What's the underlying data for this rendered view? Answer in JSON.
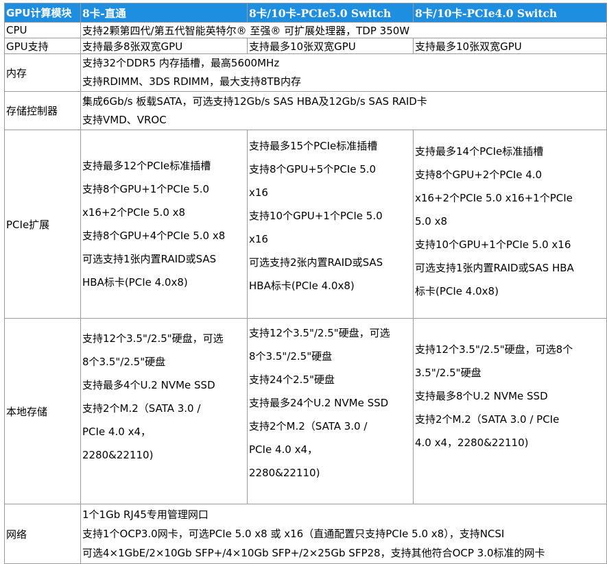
{
  "headers": [
    "GPU计算模块",
    "8卡-直通",
    "8卡/10卡-PCIe5.0 Switch",
    "8卡/10卡-PCIe4.0 Switch"
  ],
  "rows": {
    "cpu": {
      "label": "CPU",
      "value": "支持2颗第四代/第五代智能英特尔® 至强® 可扩展处理器，TDP 350W"
    },
    "gpu": {
      "label": "GPU支持",
      "col1": "支持最多8张双宽GPU",
      "col2": "支持最多10张双宽GPU",
      "col3": "支持最多10张双宽GPU"
    },
    "memory": {
      "label": "内存",
      "lines": [
        "支持32个DDR5 内存插槽，最高5600MHz",
        "支持RDIMM、3DS RDIMM，最大支持8TB内存"
      ]
    },
    "controller": {
      "label": "存储控制器",
      "lines": [
        "集成6Gb/s 板载SATA，可选支持12Gb/s SAS HBA及12Gb/s SAS RAID卡",
        "支持VMD、VROC"
      ]
    },
    "pcie": {
      "label": "PCIe扩展",
      "col1": [
        "支持最多12个PCIe标准插槽",
        "支持8个GPU+1个PCIe 5.0",
        "x16+2个PCIe 5.0 x8",
        "支持8个GPU+4个PCIe 5.0 x8",
        "可选支持1张内置RAID或SAS",
        "HBA标卡(PCIe 4.0x8)"
      ],
      "col2": [
        "支持最多15个PCIe标准插槽",
        "支持8个GPU+5个PCIe 5.0",
        "x16",
        "支持10个GPU+1个PCIe 5.0",
        "x16",
        "可选支持2张内置RAID或SAS",
        "HBA标卡(PCIe 4.0x8)"
      ],
      "col3": [
        "支持最多14个PCIe标准插槽",
        "支持8个GPU+2个PCIe 4.0",
        "x16+2个PCIe 5.0 x16+1个PCIe",
        "5.0 x8",
        "支持10个GPU+1个PCIe 5.0 x16",
        "可选支持1张内置RAID或SAS HBA",
        "标卡(PCIe 4.0x8)"
      ]
    },
    "storage": {
      "label": "本地存储",
      "col1": [
        "支持12个3.5\"/2.5\"硬盘，可选",
        "8个3.5\"/2.5\"硬盘",
        "支持最多4个U.2 NVMe SSD",
        "支持2个M.2（SATA 3.0 /",
        "PCIe 4.0 x4，",
        "2280&22110)"
      ],
      "col2": [
        "支持12个3.5\"/2.5\"硬盘，可选",
        "8个3.5\"/2.5\"硬盘",
        "支持24个2.5\"硬盘",
        "支持最多24个U.2 NVMe SSD",
        "支持2个M.2（SATA 3.0 /",
        "PCIe 4.0 x4，",
        "2280&22110)"
      ],
      "col3": [
        "支持12个3.5\"/2.5\"硬盘，可选8个",
        "3.5\"/2.5\"硬盘",
        "支持最多8个U.2 NVMe SSD",
        "支持2个M.2（SATA 3.0 / PCIe",
        "4.0 x4，2280&22110)"
      ]
    },
    "network": {
      "label": "网络",
      "lines": [
        "1个1Gb RJ45专用管理网口",
        "支持1个OCP3.0网卡，可选PCIe 5.0 x8 或 x16（直通配置只支持PCIe 5.0 x8），支持NCSI",
        "可选4×1GbE/2×10Gb SFP+/4×10Gb SFP+/2×25Gb SFP28，支持其他符合OCP 3.0标准的网卡"
      ]
    }
  }
}
